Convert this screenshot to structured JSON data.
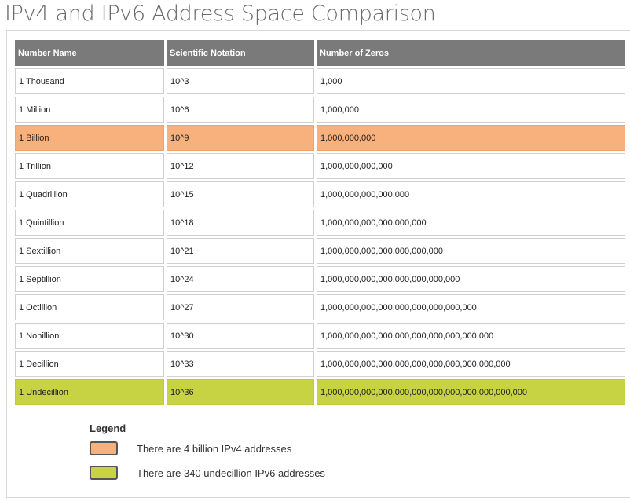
{
  "title": "IPv4 and IPv6 Address Space Comparison",
  "table": {
    "headers": [
      "Number Name",
      "Scientific Notation",
      "Number of Zeros"
    ],
    "rows": [
      [
        "1 Thousand",
        "10^3",
        "1,000"
      ],
      [
        "1 Million",
        "10^6",
        "1,000,000"
      ],
      [
        "1 Billion",
        "10^9",
        "1,000,000,000"
      ],
      [
        "1 Trillion",
        "10^12",
        "1,000,000,000,000"
      ],
      [
        "1 Quadrillion",
        "10^15",
        "1,000,000,000,000,000"
      ],
      [
        "1 Quintillion",
        "10^18",
        "1,000,000,000,000,000,000"
      ],
      [
        "1 Sextillion",
        "10^21",
        "1,000,000,000,000,000,000,000"
      ],
      [
        "1 Septillion",
        "10^24",
        "1,000,000,000,000,000,000,000,000"
      ],
      [
        "1 Octillion",
        "10^27",
        "1,000,000,000,000,000,000,000,000,000"
      ],
      [
        "1 Nonillion",
        "10^30",
        "1,000,000,000,000,000,000,000,000,000,000"
      ],
      [
        "1 Decillion",
        "10^33",
        "1,000,000,000,000,000,000,000,000,000,000,000"
      ],
      [
        "1 Undecillion",
        "10^36",
        "1,000,000,000,000,000,000,000,000,000,000,000,000"
      ]
    ],
    "highlight_colors": {
      "ipv4": "#f8b07c",
      "ipv6": "#c8d343"
    }
  },
  "legend": {
    "title": "Legend",
    "items": [
      {
        "text": "There are 4 billion IPv4 addresses",
        "color": "#f8b07c"
      },
      {
        "text": "There are 340 undecillion IPv6 addresses",
        "color": "#c8d343"
      }
    ]
  }
}
